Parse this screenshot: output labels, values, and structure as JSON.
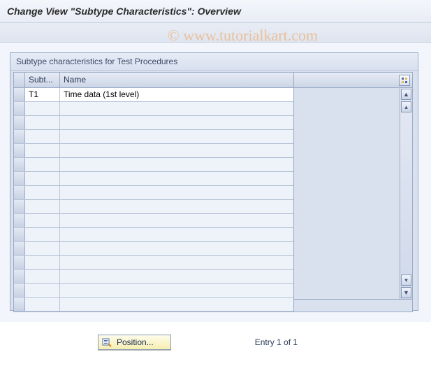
{
  "watermark": "© www.tutorialkart.com",
  "title": "Change View \"Subtype Characteristics\": Overview",
  "panel": {
    "heading": "Subtype characteristics for Test Procedures",
    "columns": {
      "sel": "",
      "subt": "Subt...",
      "name": "Name"
    },
    "rows": [
      {
        "subt": "T1",
        "name": "Time data (1st level)"
      }
    ],
    "empty_row_count": 15
  },
  "footer": {
    "position_label": "Position...",
    "entry_text": "Entry 1 of 1"
  }
}
